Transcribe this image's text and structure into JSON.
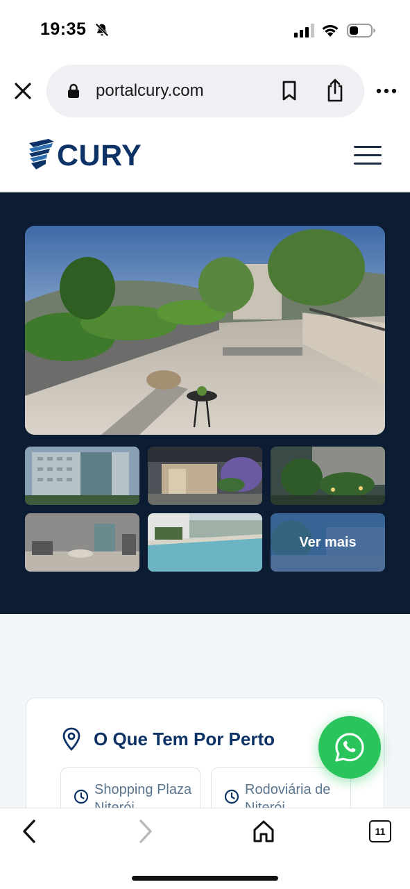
{
  "status_bar": {
    "time": "19:35",
    "icons": [
      "bell-slash-icon",
      "signal-icon",
      "wifi-icon",
      "battery-icon"
    ]
  },
  "browser": {
    "url": "portalcury.com",
    "icons": [
      "close-icon",
      "lock-icon",
      "bookmark-icon",
      "share-icon",
      "more-icon"
    ]
  },
  "site_header": {
    "logo_text": "CURY",
    "brand_color": "#0d3366",
    "menu_icon": "hamburger-icon"
  },
  "gallery": {
    "background": "#0c1c33",
    "more_label": "Ver mais",
    "thumbnail_count": 6
  },
  "nearby": {
    "title": "O Que Tem Por Perto",
    "places": [
      {
        "name": "Shopping Plaza Niterói"
      },
      {
        "name": "Rodoviária de Niterói"
      }
    ]
  },
  "whatsapp": {
    "color": "#29c45b",
    "icon": "whatsapp-icon"
  },
  "bottom_bar": {
    "tab_count": "11",
    "icons": [
      "back-icon",
      "forward-icon",
      "home-icon",
      "tabs-icon"
    ]
  }
}
